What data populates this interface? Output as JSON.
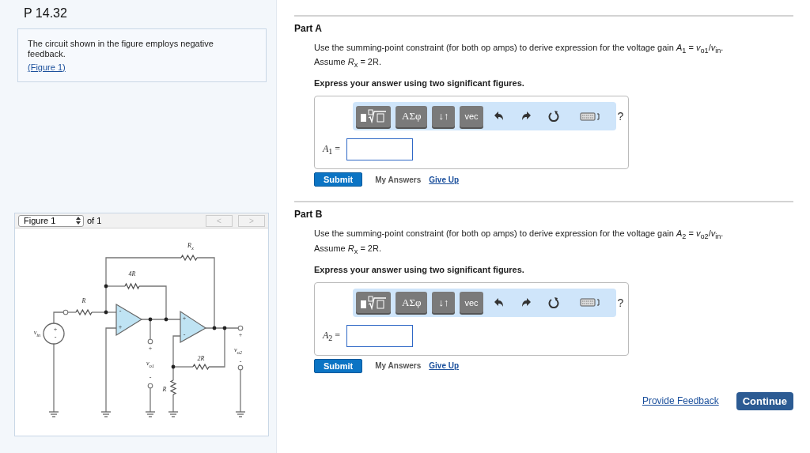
{
  "problem": {
    "title": "P 14.32",
    "intro": "The circuit shown in the figure employs negative feedback.",
    "figure_link": "(Figure 1)"
  },
  "figure_viewer": {
    "selector": "Figure 1",
    "count": "of 1",
    "prev": {
      "label": "<",
      "disabled": true
    },
    "next": {
      "label": ">",
      "disabled": true
    },
    "labels": [
      {
        "text": "R$_{x}$"
      },
      {
        "text": "4R"
      },
      {
        "text": "R"
      },
      {
        "text": "v$_{in}$"
      },
      {
        "text": "+"
      },
      {
        "text": "-"
      },
      {
        "text": "-"
      },
      {
        "text": "+"
      },
      {
        "text": "+"
      },
      {
        "text": "-"
      },
      {
        "text": "+"
      },
      {
        "text": "v$_{o1}$"
      },
      {
        "text": "-"
      },
      {
        "text": "2R"
      },
      {
        "text": "R"
      },
      {
        "text": "+"
      },
      {
        "text": "v$_{o2}$"
      },
      {
        "text": "-"
      }
    ]
  },
  "parts": [
    {
      "title": "Part A",
      "question": "Use the summing-point constraint (for both op amps) to derive expression for the voltage gain *A*$_{1}$ = *v*$_{o1}$/*v*$_{in}$.",
      "assumption": "Assume *R*$_{x}$ = 2R.",
      "instruction": "Express your answer using two significant figures.",
      "toolbar": [
        "ΑΣφ",
        "↓↑",
        "vec"
      ],
      "help": "?",
      "answer_label": "*A*$_{1}$ =",
      "submit": "Submit",
      "my_answers": "My Answers",
      "give_up": "Give Up"
    },
    {
      "title": "Part B",
      "question": "Use the summing-point constraint (for both op amps) to derive expression for the voltage gain *A*$_{2}$ = *v*$_{o2}$/*v*$_{in}$.",
      "assumption": "Assume *R*$_{x}$ = 2R.",
      "instruction": "Express your answer using two significant figures.",
      "toolbar": [
        "ΑΣφ",
        "↓↑",
        "vec"
      ],
      "help": "?",
      "answer_label": "*A*$_{2}$ =",
      "submit": "Submit",
      "my_answers": "My Answers",
      "give_up": "Give Up"
    }
  ],
  "footer": {
    "feedback": "Provide Feedback",
    "continue": "Continue"
  }
}
